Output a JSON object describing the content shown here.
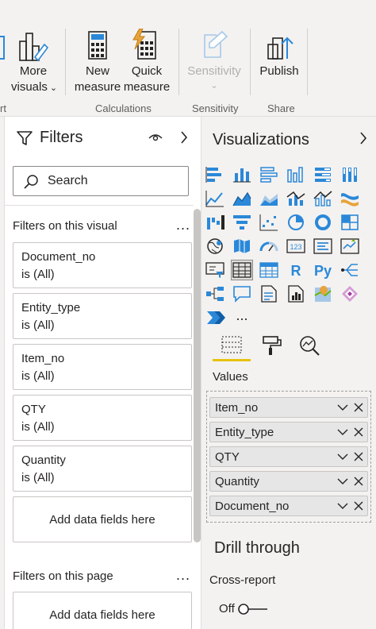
{
  "ribbon": {
    "buttons": {
      "more_visuals": {
        "line1": "More",
        "line2": "visuals"
      },
      "new_measure": {
        "line1": "New",
        "line2": "measure"
      },
      "quick_measure": {
        "line1": "Quick",
        "line2": "measure"
      },
      "sensitivity": {
        "line1": "Sensitivity"
      },
      "publish": {
        "line1": "Publish"
      }
    },
    "groups": {
      "insert_partial": "rt",
      "calculations": "Calculations",
      "sensitivity": "Sensitivity",
      "share": "Share"
    }
  },
  "filters": {
    "title": "Filters",
    "search_placeholder": "Search",
    "visual_section_label": "Filters on this visual",
    "page_section_label": "Filters on this page",
    "ellipsis": "...",
    "cards": [
      {
        "name": "Document_no",
        "value": "is (All)"
      },
      {
        "name": "Entity_type",
        "value": "is (All)"
      },
      {
        "name": "Item_no",
        "value": "is (All)"
      },
      {
        "name": "QTY",
        "value": "is (All)"
      },
      {
        "name": "Quantity",
        "value": "is (All)"
      }
    ],
    "add_fields_label": "Add data fields here"
  },
  "visualizations": {
    "title": "Visualizations",
    "icons": [
      "stacked-bar-chart-icon",
      "stacked-column-chart-icon",
      "clustered-bar-chart-icon",
      "clustered-column-chart-icon",
      "100-stacked-bar-chart-icon",
      "100-stacked-column-chart-icon",
      "line-chart-icon",
      "area-chart-icon",
      "stacked-area-chart-icon",
      "line-and-stacked-column-chart-icon",
      "line-and-clustered-column-chart-icon",
      "ribbon-chart-icon",
      "waterfall-chart-icon",
      "funnel-chart-icon",
      "scatter-chart-icon",
      "pie-chart-icon",
      "donut-chart-icon",
      "treemap-icon",
      "map-icon",
      "filled-map-icon",
      "gauge-icon",
      "card-icon",
      "multi-row-card-icon",
      "kpi-icon",
      "slicer-icon",
      "table-icon",
      "matrix-icon",
      "r-script-visual-icon",
      "python-visual-icon",
      "key-influencers-icon",
      "decomposition-tree-icon",
      "qa-icon",
      "smart-narrative-icon",
      "paginated-report-icon",
      "azure-map-icon",
      "power-apps-icon",
      "power-automate-icon",
      "more-visuals-icon"
    ],
    "r_label": "R",
    "py_label": "Py",
    "card_label": "123",
    "more_label": "...",
    "values_label": "Values",
    "value_fields": [
      "Item_no",
      "Entity_type",
      "QTY",
      "Quantity",
      "Document_no"
    ],
    "drill_through_title": "Drill through",
    "cross_report_label": "Cross-report",
    "cross_report_state": "Off"
  },
  "colors": {
    "accent_yellow": "#e8c20f",
    "brand_blue": "#2b88d8",
    "pane_bg": "#f3f2f1",
    "text": "#252423"
  }
}
